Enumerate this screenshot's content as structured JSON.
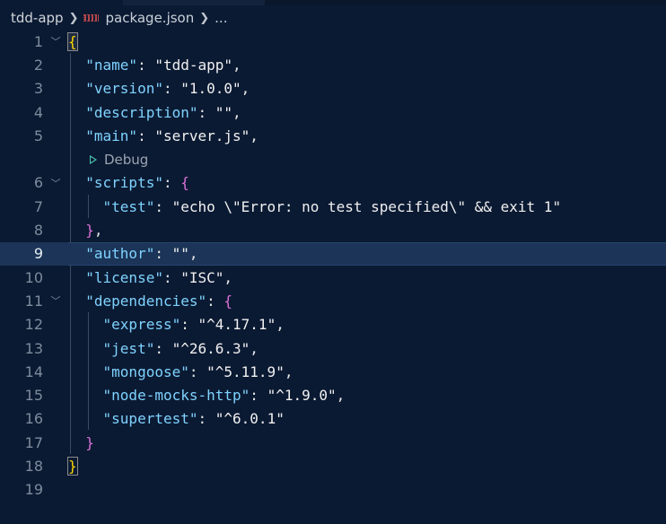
{
  "breadcrumb": {
    "folder": "tdd-app",
    "file": "package.json",
    "ellipsis": "..."
  },
  "codelens": {
    "debug_label": "Debug"
  },
  "editor": {
    "active_line": 9,
    "line_numbers": [
      "1",
      "2",
      "3",
      "4",
      "5",
      "6",
      "7",
      "8",
      "9",
      "10",
      "11",
      "12",
      "13",
      "14",
      "15",
      "16",
      "17",
      "18",
      "19"
    ]
  },
  "code": {
    "l1_brace": "{",
    "name_key": "\"name\"",
    "name_val": "\"tdd-app\"",
    "version_key": "\"version\"",
    "version_val": "\"1.0.0\"",
    "description_key": "\"description\"",
    "description_val": "\"\"",
    "main_key": "\"main\"",
    "main_val": "\"server.js\"",
    "scripts_key": "\"scripts\"",
    "test_key": "\"test\"",
    "test_val": "\"echo \\\"Error: no test specified\\\" && exit 1\"",
    "author_key": "\"author\"",
    "author_val": "\"\"",
    "license_key": "\"license\"",
    "license_val": "\"ISC\"",
    "deps_key": "\"dependencies\"",
    "dep_express_key": "\"express\"",
    "dep_express_val": "\"^4.17.1\"",
    "dep_jest_key": "\"jest\"",
    "dep_jest_val": "\"^26.6.3\"",
    "dep_mongoose_key": "\"mongoose\"",
    "dep_mongoose_val": "\"^5.11.9\"",
    "dep_nmh_key": "\"node-mocks-http\"",
    "dep_nmh_val": "\"^1.9.0\"",
    "dep_supertest_key": "\"supertest\"",
    "dep_supertest_val": "\"^6.0.1\""
  },
  "colors": {
    "background": "#0b1a33",
    "key": "#7fd3ff",
    "string": "#f0f0f0",
    "bracket_level1": "#ffd700",
    "bracket_level2": "#da70d6",
    "line_highlight": "#1b3457"
  }
}
